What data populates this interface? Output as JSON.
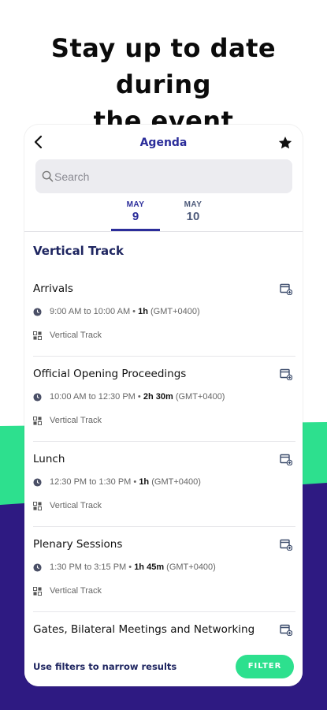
{
  "headline": {
    "line1": "Stay up to date during",
    "line2": "the event"
  },
  "colors": {
    "accent": "#2b2d9a",
    "green": "#2de08e",
    "bg_purple": "#2e1a82"
  },
  "topbar": {
    "title": "Agenda",
    "back_icon": "chevron-left-icon",
    "star_icon": "star-icon"
  },
  "search": {
    "placeholder": "Search"
  },
  "date_tabs": [
    {
      "month": "MAY",
      "day": "9",
      "selected": true
    },
    {
      "month": "MAY",
      "day": "10",
      "selected": false
    }
  ],
  "section": {
    "title": "Vertical Track"
  },
  "sessions": [
    {
      "title": "Arrivals",
      "time": "9:00 AM to 10:00 AM",
      "duration": "1h",
      "tz": "(GMT+0400)",
      "track": "Vertical Track"
    },
    {
      "title": "Official Opening Proceedings",
      "time": "10:00 AM to 12:30 PM",
      "duration": "2h 30m",
      "tz": "(GMT+0400)",
      "track": "Vertical Track"
    },
    {
      "title": "Lunch",
      "time": "12:30 PM to 1:30 PM",
      "duration": "1h",
      "tz": "(GMT+0400)",
      "track": "Vertical Track"
    },
    {
      "title": "Plenary Sessions",
      "time": "1:30 PM to 3:15 PM",
      "duration": "1h 45m",
      "tz": "(GMT+0400)",
      "track": "Vertical Track"
    },
    {
      "title": "Gates, Bilateral Meetings and Networking",
      "time": "",
      "duration": "",
      "tz": "",
      "track": ""
    }
  ],
  "footer": {
    "text": "Use filters to narrow results",
    "button": "FILTER"
  }
}
